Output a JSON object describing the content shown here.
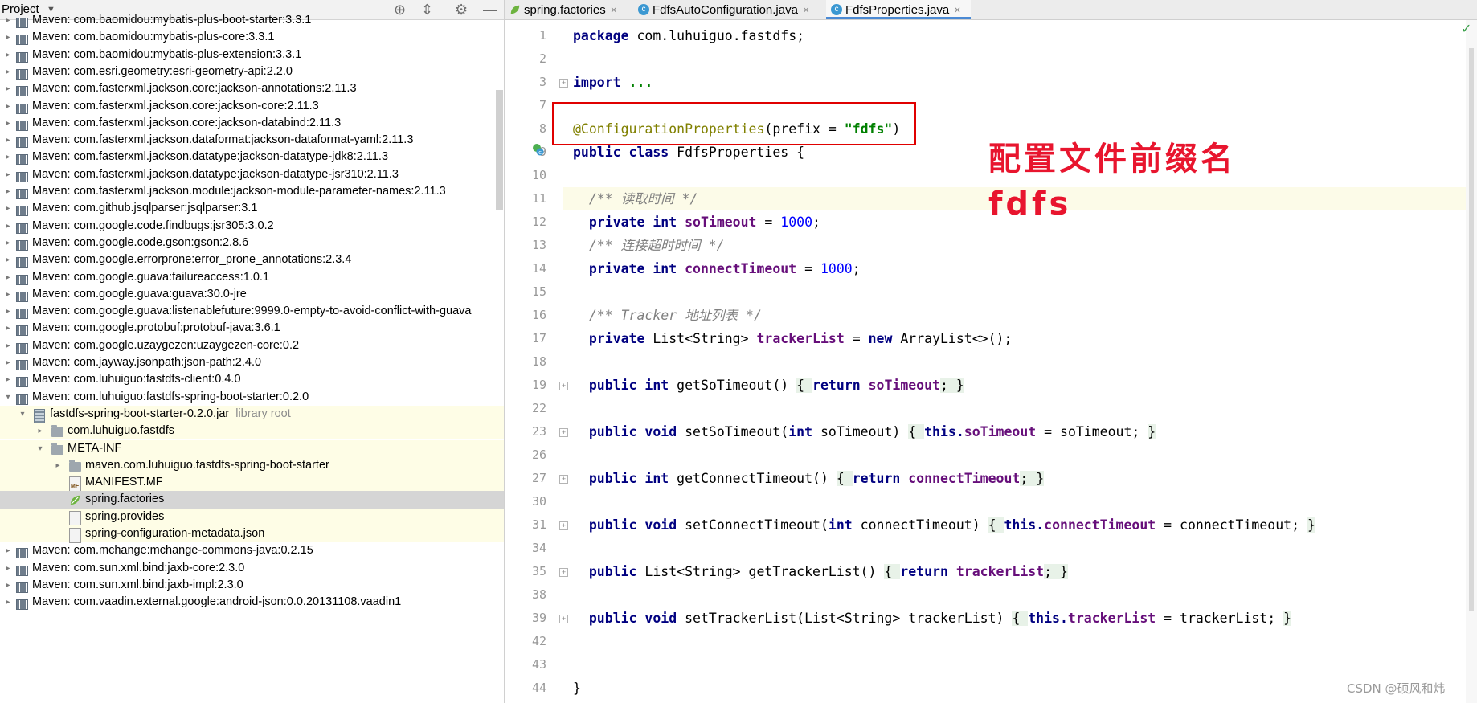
{
  "project_panel": {
    "title": "Project",
    "tree": [
      {
        "label": "Maven: com.baomidou:mybatis-plus-boot-starter:3.3.1",
        "indent": 0,
        "icon": "library",
        "arrow": "right"
      },
      {
        "label": "Maven: com.baomidou:mybatis-plus-core:3.3.1",
        "indent": 0,
        "icon": "library",
        "arrow": "right"
      },
      {
        "label": "Maven: com.baomidou:mybatis-plus-extension:3.3.1",
        "indent": 0,
        "icon": "library",
        "arrow": "right"
      },
      {
        "label": "Maven: com.esri.geometry:esri-geometry-api:2.2.0",
        "indent": 0,
        "icon": "library",
        "arrow": "right"
      },
      {
        "label": "Maven: com.fasterxml.jackson.core:jackson-annotations:2.11.3",
        "indent": 0,
        "icon": "library",
        "arrow": "right"
      },
      {
        "label": "Maven: com.fasterxml.jackson.core:jackson-core:2.11.3",
        "indent": 0,
        "icon": "library",
        "arrow": "right"
      },
      {
        "label": "Maven: com.fasterxml.jackson.core:jackson-databind:2.11.3",
        "indent": 0,
        "icon": "library",
        "arrow": "right"
      },
      {
        "label": "Maven: com.fasterxml.jackson.dataformat:jackson-dataformat-yaml:2.11.3",
        "indent": 0,
        "icon": "library",
        "arrow": "right"
      },
      {
        "label": "Maven: com.fasterxml.jackson.datatype:jackson-datatype-jdk8:2.11.3",
        "indent": 0,
        "icon": "library",
        "arrow": "right"
      },
      {
        "label": "Maven: com.fasterxml.jackson.datatype:jackson-datatype-jsr310:2.11.3",
        "indent": 0,
        "icon": "library",
        "arrow": "right"
      },
      {
        "label": "Maven: com.fasterxml.jackson.module:jackson-module-parameter-names:2.11.3",
        "indent": 0,
        "icon": "library",
        "arrow": "right"
      },
      {
        "label": "Maven: com.github.jsqlparser:jsqlparser:3.1",
        "indent": 0,
        "icon": "library",
        "arrow": "right"
      },
      {
        "label": "Maven: com.google.code.findbugs:jsr305:3.0.2",
        "indent": 0,
        "icon": "library",
        "arrow": "right"
      },
      {
        "label": "Maven: com.google.code.gson:gson:2.8.6",
        "indent": 0,
        "icon": "library",
        "arrow": "right"
      },
      {
        "label": "Maven: com.google.errorprone:error_prone_annotations:2.3.4",
        "indent": 0,
        "icon": "library",
        "arrow": "right"
      },
      {
        "label": "Maven: com.google.guava:failureaccess:1.0.1",
        "indent": 0,
        "icon": "library",
        "arrow": "right"
      },
      {
        "label": "Maven: com.google.guava:guava:30.0-jre",
        "indent": 0,
        "icon": "library",
        "arrow": "right"
      },
      {
        "label": "Maven: com.google.guava:listenablefuture:9999.0-empty-to-avoid-conflict-with-guava",
        "indent": 0,
        "icon": "library",
        "arrow": "right"
      },
      {
        "label": "Maven: com.google.protobuf:protobuf-java:3.6.1",
        "indent": 0,
        "icon": "library",
        "arrow": "right"
      },
      {
        "label": "Maven: com.google.uzaygezen:uzaygezen-core:0.2",
        "indent": 0,
        "icon": "library",
        "arrow": "right"
      },
      {
        "label": "Maven: com.jayway.jsonpath:json-path:2.4.0",
        "indent": 0,
        "icon": "library",
        "arrow": "right"
      },
      {
        "label": "Maven: com.luhuiguo:fastdfs-client:0.4.0",
        "indent": 0,
        "icon": "library",
        "arrow": "right"
      },
      {
        "label": "Maven: com.luhuiguo:fastdfs-spring-boot-starter:0.2.0",
        "indent": 0,
        "icon": "library",
        "arrow": "down"
      },
      {
        "label": "fastdfs-spring-boot-starter-0.2.0.jar",
        "note": "library root",
        "indent": 1,
        "icon": "jar",
        "arrow": "down",
        "jar_area": true
      },
      {
        "label": "com.luhuiguo.fastdfs",
        "indent": 2,
        "icon": "folder",
        "arrow": "right",
        "jar_area": true
      },
      {
        "label": "META-INF",
        "indent": 2,
        "icon": "folder",
        "arrow": "down",
        "jar_area": true
      },
      {
        "label": "maven.com.luhuiguo.fastdfs-spring-boot-starter",
        "indent": 3,
        "icon": "folder",
        "arrow": "right",
        "jar_area": true
      },
      {
        "label": "MANIFEST.MF",
        "indent": 3,
        "icon": "manifest",
        "arrow": "none",
        "jar_area": true
      },
      {
        "label": "spring.factories",
        "indent": 3,
        "icon": "spring",
        "arrow": "none",
        "selected": true
      },
      {
        "label": "spring.provides",
        "indent": 3,
        "icon": "file",
        "arrow": "none",
        "jar_area": true
      },
      {
        "label": "spring-configuration-metadata.json",
        "indent": 3,
        "icon": "file",
        "arrow": "none",
        "jar_area": true
      },
      {
        "label": "Maven: com.mchange:mchange-commons-java:0.2.15",
        "indent": 0,
        "icon": "library",
        "arrow": "right"
      },
      {
        "label": "Maven: com.sun.xml.bind:jaxb-core:2.3.0",
        "indent": 0,
        "icon": "library",
        "arrow": "right"
      },
      {
        "label": "Maven: com.sun.xml.bind:jaxb-impl:2.3.0",
        "indent": 0,
        "icon": "library",
        "arrow": "right"
      },
      {
        "label": "Maven: com.vaadin.external.google:android-json:0.0.20131108.vaadin1",
        "indent": 0,
        "icon": "library",
        "arrow": "right"
      }
    ]
  },
  "editor": {
    "tabs": [
      {
        "label": "spring.factories",
        "icon": "spring-icon",
        "active": false
      },
      {
        "label": "FdfsAutoConfiguration.java",
        "icon": "class-icon",
        "active": false
      },
      {
        "label": "FdfsProperties.java",
        "icon": "class-icon",
        "active": true
      }
    ],
    "lines": [
      {
        "n": "1",
        "fold": false,
        "segs": [
          {
            "t": "package ",
            "c": "kw"
          },
          {
            "t": "com.luhuiguo.fastdfs;",
            "c": ""
          }
        ]
      },
      {
        "n": "2",
        "fold": false,
        "segs": []
      },
      {
        "n": "3",
        "fold": true,
        "segs": [
          {
            "t": "import ",
            "c": "kw"
          },
          {
            "t": "...",
            "c": "str"
          }
        ]
      },
      {
        "n": "7",
        "fold": false,
        "segs": []
      },
      {
        "n": "8",
        "fold": false,
        "segs": [
          {
            "t": "@ConfigurationProperties",
            "c": "ann"
          },
          {
            "t": "(prefix = ",
            "c": ""
          },
          {
            "t": "\"fdfs\"",
            "c": "str"
          },
          {
            "t": ")",
            "c": ""
          }
        ]
      },
      {
        "n": "9",
        "fold": false,
        "segs": [
          {
            "t": "public class ",
            "c": "kw"
          },
          {
            "t": "FdfsProperties {",
            "c": ""
          }
        ]
      },
      {
        "n": "10",
        "fold": false,
        "segs": []
      },
      {
        "n": "11",
        "fold": false,
        "current": true,
        "caret": true,
        "segs": [
          {
            "t": "  /** 读取时间 */",
            "c": "cmt"
          }
        ]
      },
      {
        "n": "12",
        "fold": false,
        "segs": [
          {
            "t": "  private int ",
            "c": "kw"
          },
          {
            "t": "soTimeout",
            "c": "field"
          },
          {
            "t": " = ",
            "c": ""
          },
          {
            "t": "1000",
            "c": "num"
          },
          {
            "t": ";",
            "c": ""
          }
        ]
      },
      {
        "n": "13",
        "fold": false,
        "segs": [
          {
            "t": "  /** 连接超时时间 */",
            "c": "cmt"
          }
        ]
      },
      {
        "n": "14",
        "fold": false,
        "segs": [
          {
            "t": "  private int ",
            "c": "kw"
          },
          {
            "t": "connectTimeout",
            "c": "field"
          },
          {
            "t": " = ",
            "c": ""
          },
          {
            "t": "1000",
            "c": "num"
          },
          {
            "t": ";",
            "c": ""
          }
        ]
      },
      {
        "n": "15",
        "fold": false,
        "segs": []
      },
      {
        "n": "16",
        "fold": false,
        "segs": [
          {
            "t": "  /** Tracker 地址列表 */",
            "c": "cmt"
          }
        ]
      },
      {
        "n": "17",
        "fold": false,
        "segs": [
          {
            "t": "  private ",
            "c": "kw"
          },
          {
            "t": "List<String> ",
            "c": ""
          },
          {
            "t": "trackerList",
            "c": "field"
          },
          {
            "t": " = ",
            "c": ""
          },
          {
            "t": "new ",
            "c": "kw"
          },
          {
            "t": "ArrayList<>();",
            "c": ""
          }
        ]
      },
      {
        "n": "18",
        "fold": false,
        "segs": []
      },
      {
        "n": "19",
        "fold": true,
        "segs": [
          {
            "t": "  public int ",
            "c": "kw"
          },
          {
            "t": "getSoTimeout() ",
            "c": ""
          },
          {
            "t": "{ ",
            "c": "brace-hl"
          },
          {
            "t": "return ",
            "c": "kw"
          },
          {
            "t": "soTimeout",
            "c": "field"
          },
          {
            "t": "; }",
            "c": "brace-hl"
          }
        ]
      },
      {
        "n": "22",
        "fold": false,
        "segs": []
      },
      {
        "n": "23",
        "fold": true,
        "segs": [
          {
            "t": "  public void ",
            "c": "kw"
          },
          {
            "t": "setSoTimeout(",
            "c": ""
          },
          {
            "t": "int ",
            "c": "kw"
          },
          {
            "t": "soTimeout) ",
            "c": ""
          },
          {
            "t": "{ ",
            "c": "brace-hl"
          },
          {
            "t": "this.",
            "c": "kw"
          },
          {
            "t": "soTimeout",
            "c": "field"
          },
          {
            "t": " = soTimeout; ",
            "c": ""
          },
          {
            "t": "}",
            "c": "brace-hl"
          }
        ]
      },
      {
        "n": "26",
        "fold": false,
        "segs": []
      },
      {
        "n": "27",
        "fold": true,
        "segs": [
          {
            "t": "  public int ",
            "c": "kw"
          },
          {
            "t": "getConnectTimeout() ",
            "c": ""
          },
          {
            "t": "{ ",
            "c": "brace-hl"
          },
          {
            "t": "return ",
            "c": "kw"
          },
          {
            "t": "connectTimeout",
            "c": "field"
          },
          {
            "t": "; }",
            "c": "brace-hl"
          }
        ]
      },
      {
        "n": "30",
        "fold": false,
        "segs": []
      },
      {
        "n": "31",
        "fold": true,
        "segs": [
          {
            "t": "  public void ",
            "c": "kw"
          },
          {
            "t": "setConnectTimeout(",
            "c": ""
          },
          {
            "t": "int ",
            "c": "kw"
          },
          {
            "t": "connectTimeout) ",
            "c": ""
          },
          {
            "t": "{ ",
            "c": "brace-hl"
          },
          {
            "t": "this.",
            "c": "kw"
          },
          {
            "t": "connectTimeout",
            "c": "field"
          },
          {
            "t": " = connectTimeout; ",
            "c": ""
          },
          {
            "t": "}",
            "c": "brace-hl"
          }
        ]
      },
      {
        "n": "34",
        "fold": false,
        "segs": []
      },
      {
        "n": "35",
        "fold": true,
        "segs": [
          {
            "t": "  public ",
            "c": "kw"
          },
          {
            "t": "List<String> getTrackerList() ",
            "c": ""
          },
          {
            "t": "{ ",
            "c": "brace-hl"
          },
          {
            "t": "return ",
            "c": "kw"
          },
          {
            "t": "trackerList",
            "c": "field"
          },
          {
            "t": "; }",
            "c": "brace-hl"
          }
        ]
      },
      {
        "n": "38",
        "fold": false,
        "segs": []
      },
      {
        "n": "39",
        "fold": true,
        "segs": [
          {
            "t": "  public void ",
            "c": "kw"
          },
          {
            "t": "setTrackerList(List<String> trackerList) ",
            "c": ""
          },
          {
            "t": "{ ",
            "c": "brace-hl"
          },
          {
            "t": "this.",
            "c": "kw"
          },
          {
            "t": "trackerList",
            "c": "field"
          },
          {
            "t": " = trackerList; ",
            "c": ""
          },
          {
            "t": "}",
            "c": "brace-hl"
          }
        ]
      },
      {
        "n": "42",
        "fold": false,
        "segs": []
      },
      {
        "n": "43",
        "fold": false,
        "segs": []
      },
      {
        "n": "44",
        "fold": false,
        "segs": [
          {
            "t": "}",
            "c": ""
          }
        ]
      }
    ]
  },
  "overlay": {
    "note_line1": "配置文件前缀名",
    "note_line2": "fdfs",
    "note_color": "#e8152e",
    "box_color": "#e00000"
  },
  "watermark": "CSDN @硕风和炜",
  "colors": {
    "keyword": "#000080",
    "annotation": "#808000",
    "string": "#008000",
    "number": "#0000ff",
    "field": "#660e7a",
    "comment": "#808080",
    "selection": "#d5d5d5",
    "jar_area": "#fefde6"
  }
}
